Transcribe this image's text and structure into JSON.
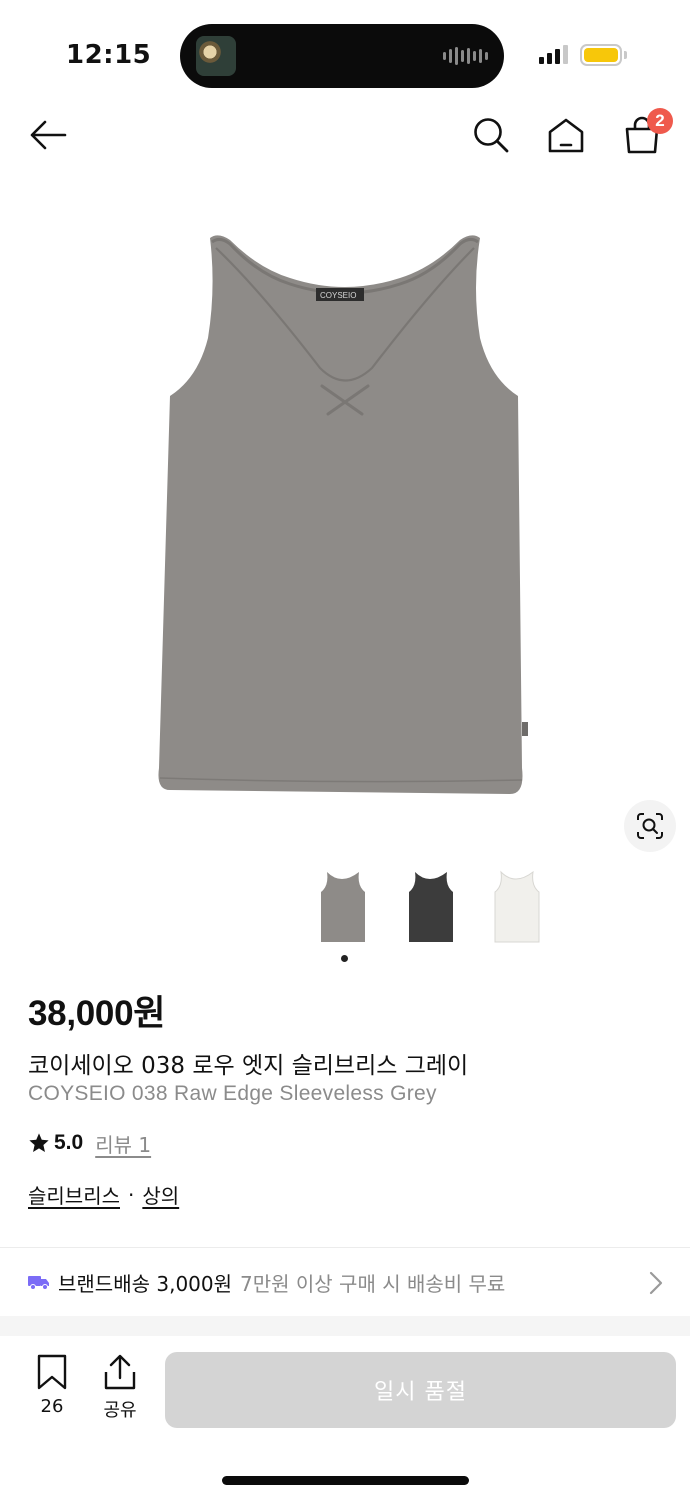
{
  "status_bar": {
    "time": "12:15",
    "battery_color": "#f7c70a",
    "signal_bars": "3 of 4"
  },
  "header": {
    "back_icon": "arrow-left-icon",
    "search_icon": "search-icon",
    "home_icon": "home-icon",
    "cart_icon": "shopping-bag-icon",
    "cart_count": "2",
    "badge_color": "#ef5a4d"
  },
  "product": {
    "image_logo": "COYSEIO",
    "thumbnails": [
      {
        "color_name": "grey",
        "fill": "#8e8b88"
      },
      {
        "color_name": "black",
        "fill": "#3c3c3c"
      },
      {
        "color_name": "white",
        "fill": "#f1f0ec"
      }
    ],
    "active_thumbnail_index": 0,
    "price": "38,000원",
    "name_ko": "코이세이오 038 로우 엣지 슬리브리스 그레이",
    "name_en": "COYSEIO 038 Raw Edge Sleeveless Grey",
    "rating": "5.0",
    "review_label": "리뷰 1",
    "categories": [
      "슬리브리스",
      "상의"
    ],
    "category_separator": "·"
  },
  "shipping": {
    "label": "브랜드배송 3,000원",
    "note": "7만원 이상 구매 시 배송비 무료",
    "icon": "truck-icon",
    "icon_color": "#7b6cf6"
  },
  "bottom_bar": {
    "bookmark_count": "26",
    "share_label": "공유",
    "soldout_label": "일시 품절",
    "soldout_bg": "#d4d4d4"
  }
}
